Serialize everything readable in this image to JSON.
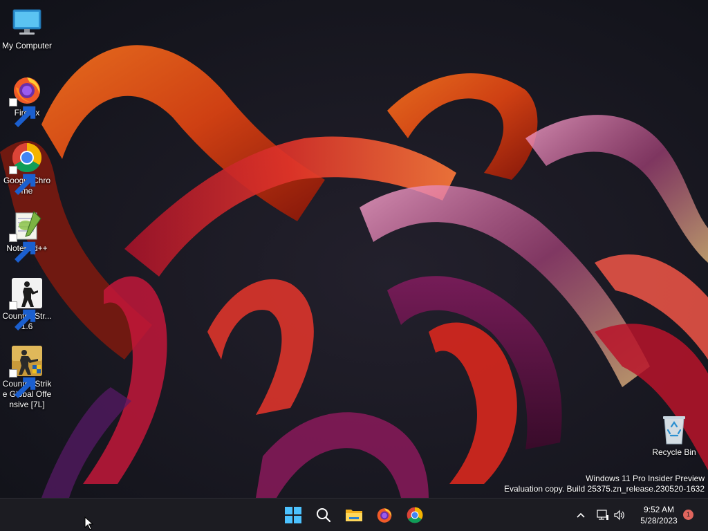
{
  "desktop": {
    "icons": [
      {
        "label": "My Computer",
        "icon": "monitor-icon"
      },
      {
        "label": "Firefox",
        "icon": "firefox-icon"
      },
      {
        "label": "Google Chrome",
        "icon": "chrome-icon"
      },
      {
        "label": "Notepad++",
        "icon": "notepadpp-icon"
      },
      {
        "label": "Counter-Str... 1.6",
        "icon": "cs16-icon"
      },
      {
        "label": "Counter-Strike Global Offensive [7L]",
        "icon": "csgo-icon"
      }
    ],
    "recycle_bin": {
      "label": "Recycle Bin",
      "icon": "recycle-bin-icon"
    }
  },
  "watermark": {
    "line1": "Windows 11 Pro Insider Preview",
    "line2": "Evaluation copy. Build 25375.zn_release.230520-1632"
  },
  "taskbar": {
    "background": "#1c1c22",
    "pinned": [
      {
        "name": "start",
        "icon": "windows-start-icon"
      },
      {
        "name": "search",
        "icon": "search-icon"
      },
      {
        "name": "file-explorer",
        "icon": "folder-icon"
      },
      {
        "name": "firefox",
        "icon": "firefox-icon"
      },
      {
        "name": "chrome",
        "icon": "chrome-icon"
      }
    ],
    "tray": {
      "overflow_icon": "chevron-up-icon",
      "network_icon": "network-icon",
      "volume_icon": "speaker-icon",
      "time": "9:52 AM",
      "date": "5/28/2023",
      "notification_count": "1"
    }
  }
}
